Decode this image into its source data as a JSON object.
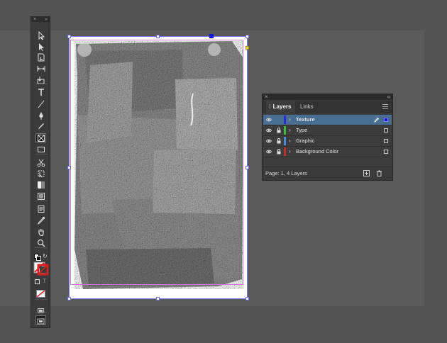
{
  "layers_panel": {
    "tabs": [
      {
        "label": "Layers",
        "active": true
      },
      {
        "label": "Links",
        "active": false
      }
    ],
    "layers": [
      {
        "name": "Texture",
        "color": "#2b2bd6",
        "selected": true,
        "locked": false
      },
      {
        "name": "Type",
        "color": "#3fb83f",
        "selected": false,
        "locked": true
      },
      {
        "name": "Graphic",
        "color": "#4a8ad8",
        "selected": false,
        "locked": true
      },
      {
        "name": "Background Color",
        "color": "#c0302b",
        "selected": false,
        "locked": true
      }
    ],
    "footer_text": "Page: 1, 4 Layers"
  },
  "tools": [
    {
      "name": "selection-tool-icon"
    },
    {
      "name": "direct-selection-tool-icon"
    },
    {
      "name": "page-tool-icon"
    },
    {
      "name": "gap-tool-icon"
    },
    {
      "name": "content-collector-tool-icon"
    },
    {
      "name": "type-tool-icon"
    },
    {
      "name": "line-tool-icon"
    },
    {
      "name": "pen-tool-icon"
    },
    {
      "name": "pencil-tool-icon"
    },
    {
      "name": "rectangle-frame-tool-icon",
      "active": true
    },
    {
      "name": "rectangle-tool-icon"
    },
    {
      "name": "scissors-tool-icon"
    },
    {
      "name": "free-transform-tool-icon"
    },
    {
      "name": "gradient-swatch-tool-icon"
    },
    {
      "name": "gradient-feather-tool-icon"
    },
    {
      "name": "note-tool-icon"
    },
    {
      "name": "eyedropper-tool-icon"
    },
    {
      "name": "hand-tool-icon"
    },
    {
      "name": "zoom-tool-icon"
    }
  ]
}
